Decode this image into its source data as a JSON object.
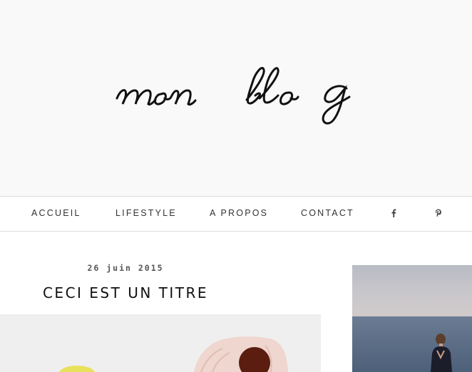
{
  "header": {
    "logo_text": "mon blog"
  },
  "nav": {
    "items": [
      {
        "label": "ACCUEIL"
      },
      {
        "label": "LIFESTYLE"
      },
      {
        "label": "A PROPOS"
      },
      {
        "label": "CONTACT"
      }
    ],
    "social": [
      {
        "icon": "facebook-icon"
      },
      {
        "icon": "pinterest-icon"
      }
    ]
  },
  "post": {
    "date": "26 juin 2015",
    "title": "CECI EST UN TITRE"
  },
  "colors": {
    "header_bg": "#f9f9f9",
    "divider": "#dddddd",
    "text": "#333333"
  }
}
